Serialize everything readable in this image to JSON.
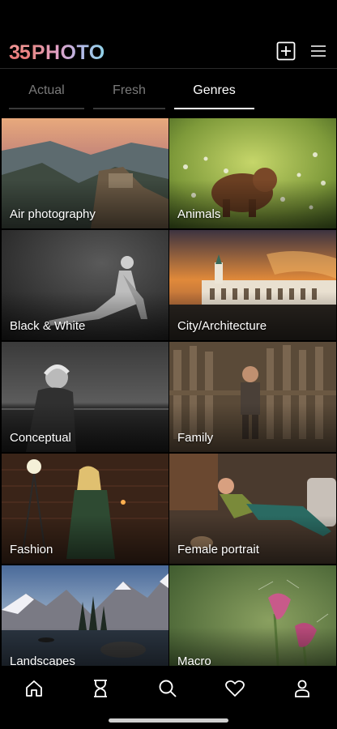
{
  "header": {
    "logo_mark": "35",
    "logo_text": "PHOTO",
    "add_icon": "plus-square-icon",
    "menu_icon": "hamburger-menu-icon"
  },
  "tabs": [
    {
      "label": "Actual",
      "active": false
    },
    {
      "label": "Fresh",
      "active": false
    },
    {
      "label": "Genres",
      "active": true
    }
  ],
  "genres": [
    {
      "label": "Air photography"
    },
    {
      "label": "Animals"
    },
    {
      "label": "Black & White"
    },
    {
      "label": "City/Architecture"
    },
    {
      "label": "Conceptual"
    },
    {
      "label": "Family"
    },
    {
      "label": "Fashion"
    },
    {
      "label": "Female portrait"
    },
    {
      "label": "Landscapes"
    },
    {
      "label": "Macro"
    }
  ],
  "bottom_nav": [
    {
      "icon": "home-icon"
    },
    {
      "icon": "hourglass-icon"
    },
    {
      "icon": "search-icon"
    },
    {
      "icon": "heart-icon"
    },
    {
      "icon": "profile-icon"
    }
  ],
  "colors": {
    "background": "#000000",
    "active_tab": "#ffffff",
    "inactive_tab": "#7a7a7a"
  }
}
